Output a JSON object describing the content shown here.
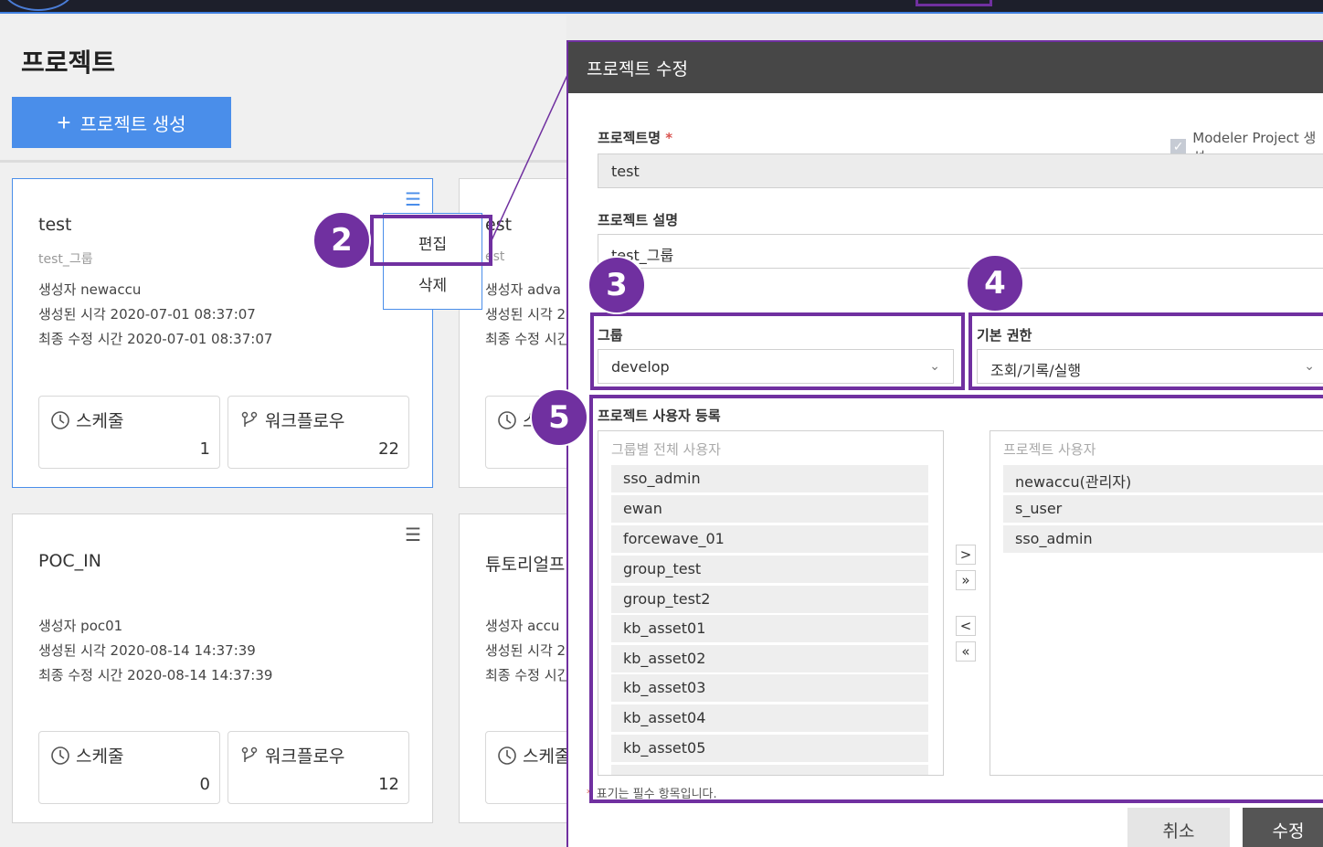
{
  "page": {
    "title": "프로젝트",
    "create_button": "프로젝트 생성"
  },
  "cards": [
    {
      "title": "test",
      "subtitle": "test_그룹",
      "creator": "생성자 newaccu",
      "created": "생성된 시각 2020-07-01 08:37:07",
      "modified": "최종 수정 시간 2020-07-01 08:37:07",
      "schedule_label": "스케줄",
      "schedule_count": "1",
      "workflow_label": "워크플로우",
      "workflow_count": "22"
    },
    {
      "title": "est",
      "subtitle": "est",
      "creator": "생성자 adva",
      "created": "생성된 시각 2",
      "modified": "최종 수정 시긴",
      "schedule_label": "스"
    },
    {
      "title": "POC_IN",
      "creator": "생성자 poc01",
      "created": "생성된 시각 2020-08-14 14:37:39",
      "modified": "최종 수정 시간 2020-08-14 14:37:39",
      "schedule_label": "스케줄",
      "schedule_count": "0",
      "workflow_label": "워크플로우",
      "workflow_count": "12"
    },
    {
      "title": "튜토리얼프",
      "creator": "생성자 accu",
      "created": "생성된 시각 2",
      "modified": "최종 수정 시긴",
      "schedule_label": "스케줄"
    }
  ],
  "context_menu": {
    "edit": "편집",
    "delete": "삭제"
  },
  "badges": {
    "b2": "2",
    "b3": "3",
    "b4": "4",
    "b5": "5"
  },
  "modal": {
    "title": "프로젝트 수정",
    "name_label": "프로젝트명",
    "required_mark": "*",
    "name_value": "test",
    "modeler_checkbox_label": "Modeler Project 생성",
    "desc_label": "프로젝트 설명",
    "desc_value": "test_그룹",
    "group_label": "그룹",
    "group_value": "develop",
    "permission_label": "기본 권한",
    "permission_value": "조회/기록/실행",
    "users_label": "프로젝트 사용자 등록",
    "all_users_title": "그룹별 전체 사용자",
    "all_users": [
      "sso_admin",
      "ewan",
      "forcewave_01",
      "group_test",
      "group_test2",
      "kb_asset01",
      "kb_asset02",
      "kb_asset03",
      "kb_asset04",
      "kb_asset05"
    ],
    "project_users_title": "프로젝트 사용자",
    "project_users": [
      "newaccu(관리자)",
      "s_user",
      "sso_admin"
    ],
    "arrows": {
      "add": ">",
      "add_all": "»",
      "remove": "<",
      "remove_all": "«"
    },
    "required_note": "표기는 필수 항목입니다.",
    "cancel_button": "취소",
    "submit_button": "수정"
  },
  "colors": {
    "accent": "#4a8eea",
    "highlight": "#7030a0",
    "modal_header": "#474747",
    "required": "#d9534f"
  }
}
